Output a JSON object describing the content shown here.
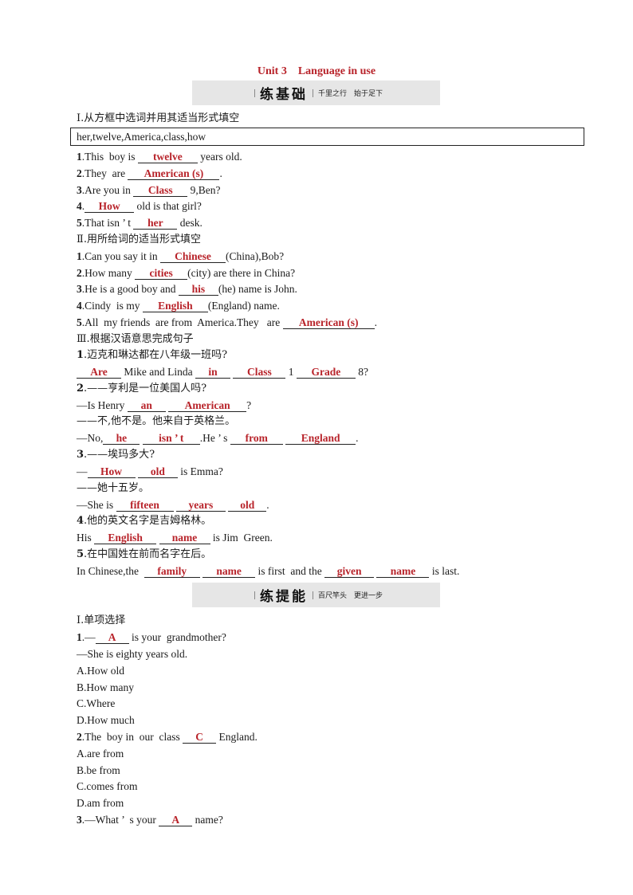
{
  "title": "Unit 3　Language in use",
  "banner1": {
    "big": "练基础",
    "small": "千里之行　始于足下"
  },
  "banner2": {
    "big": "练提能",
    "small": "百尺竿头　更进一步"
  },
  "part1": {
    "heading": "Ⅰ.从方框中选词并用其适当形式填空",
    "wordbox": "her,twelve,America,class,how",
    "items": [
      {
        "num": "1",
        "pre": ".This  boy is ",
        "ans": "twelve",
        "post": " years old."
      },
      {
        "num": "2",
        "pre": ".They  are ",
        "ans": "American (s)",
        "post": "."
      },
      {
        "num": "3",
        "pre": ".Are you in ",
        "ans": "Class",
        "post": " 9,Ben?"
      },
      {
        "num": "4",
        "pre": ".",
        "ans": "How",
        "post": " old is that girl?"
      },
      {
        "num": "5",
        "pre": ".That isn ’ t ",
        "ans": "her",
        "post": " desk."
      }
    ]
  },
  "part2": {
    "heading": "Ⅱ.用所给词的适当形式填空",
    "items": [
      {
        "num": "1",
        "pre": ".Can you say it in ",
        "ans": "Chinese",
        "post": "(China),Bob?"
      },
      {
        "num": "2",
        "pre": ".How many ",
        "ans": "cities",
        "post": "(city)  are there in  China?"
      },
      {
        "num": "3",
        "pre": ".He is a good boy and ",
        "ans": "his",
        "post": "(he)  name  is John."
      },
      {
        "num": "4",
        "pre": ".Cindy  is my ",
        "ans": "English",
        "post": "(England)  name."
      },
      {
        "num": "5",
        "pre": ".All  my friends  are from  America.They   are ",
        "ans": "American (s)",
        "post": "."
      }
    ]
  },
  "part3": {
    "heading": "Ⅲ.根据汉语意思完成句子",
    "q1": {
      "num": "1",
      "cn": ".迈克和琳达都在八年级一班吗?",
      "a": [
        "Are",
        " Mike and Linda ",
        "in",
        " ",
        "Class",
        " 1 ",
        "Grade",
        " 8?"
      ]
    },
    "q2": {
      "num": "2",
      "cn": ".——亨利是一位美国人吗?",
      "l1": [
        "—Is Henry ",
        "an",
        " ",
        "American",
        "?"
      ],
      "cn2": "——不,他不是。他来自于英格兰。",
      "l2": [
        "—No,",
        "he",
        " ",
        "isn ’ t",
        ".He ’ s ",
        "from",
        " ",
        "England",
        "."
      ]
    },
    "q3": {
      "num": "3",
      "cn": ".——埃玛多大?",
      "l1": [
        "—",
        "How",
        " ",
        "old",
        " is Emma?"
      ],
      "cn2": "——她十五岁。",
      "l2": [
        "—She is ",
        "fifteen",
        " ",
        "years",
        " ",
        "old",
        "."
      ]
    },
    "q4": {
      "num": "4",
      "cn": ".他的英文名字是吉姆格林。",
      "l1": [
        "His ",
        "English",
        " ",
        "name",
        " is Jim  Green."
      ]
    },
    "q5": {
      "num": "5",
      "cn": ".在中国姓在前而名字在后。",
      "l1": [
        "In Chinese,the  ",
        "family",
        " ",
        "name",
        " is first  and the ",
        "given",
        " ",
        "name",
        " is last."
      ]
    }
  },
  "part4": {
    "heading": "Ⅰ.单项选择",
    "q1": {
      "num": "1",
      "pre": ".—",
      "ans": "A",
      "post": " is your  grandmother?",
      "l2": "—She is  eighty  years old.",
      "options": [
        "A.How  old",
        "B.How many",
        "C.Where",
        "D.How much"
      ]
    },
    "q2": {
      "num": "2",
      "pre": ".The  boy in  our  class ",
      "ans": "C",
      "post": " England.",
      "options": [
        "A.are from",
        "B.be from",
        "C.comes  from",
        "D.am from"
      ]
    },
    "q3": {
      "num": "3",
      "pre": ".—What ’  s your ",
      "ans": "A",
      "post": " name?"
    }
  },
  "colors": {
    "accent": "#b8232a",
    "banner_bg": "#e6e6e6"
  }
}
